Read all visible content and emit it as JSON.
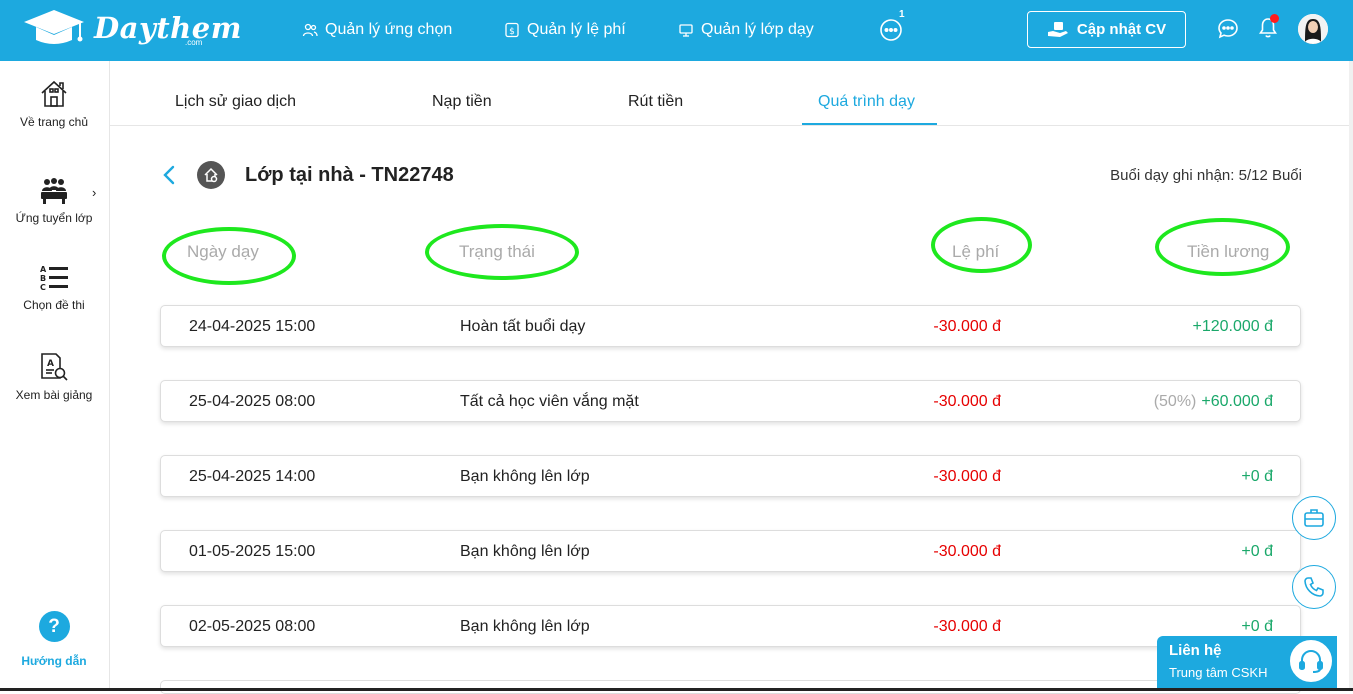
{
  "header": {
    "logo_text": "Daythem",
    "logo_sub": ".com",
    "nav": [
      {
        "label": "Quản lý ứng chọn",
        "icon": "users-icon"
      },
      {
        "label": "Quản lý lệ phí",
        "icon": "fee-icon"
      },
      {
        "label": "Quản lý lớp dạy",
        "icon": "monitor-icon"
      }
    ],
    "more_badge": "1",
    "cv_button": "Cập nhật CV"
  },
  "sidebar": {
    "items": [
      {
        "label": "Về trang chủ",
        "icon": "home-icon"
      },
      {
        "label": "Ứng tuyển lớp",
        "icon": "classroom-icon"
      },
      {
        "label": "Chọn đề thi",
        "icon": "list-icon"
      },
      {
        "label": "Xem bài giảng",
        "icon": "lecture-search-icon"
      }
    ],
    "expand_arrow": "›",
    "guide_symbol": "?",
    "guide_label": "Hướng dẫn"
  },
  "tabs": [
    {
      "label": "Lịch sử giao dịch"
    },
    {
      "label": "Nạp tiền"
    },
    {
      "label": "Rút tiền"
    },
    {
      "label": "Quá trình dạy"
    }
  ],
  "detail": {
    "class_title": "Lớp tại nhà - TN22748",
    "sessions_recorded": "Buổi dạy ghi nhận: 5/12 Buổi",
    "columns": {
      "date": "Ngày dạy",
      "status": "Trạng thái",
      "fee": "Lệ phí",
      "pay": "Tiền lương"
    },
    "rows": [
      {
        "date": "24-04-2025 15:00",
        "status": "Hoàn tất buổi dạy",
        "fee": "-30.000 đ",
        "pct": "",
        "pay": "+120.000 đ"
      },
      {
        "date": "25-04-2025 08:00",
        "status": "Tất cả học viên vắng mặt",
        "fee": "-30.000 đ",
        "pct": "(50%)",
        "pay": "+60.000 đ"
      },
      {
        "date": "25-04-2025 14:00",
        "status": "Bạn không lên lớp",
        "fee": "-30.000 đ",
        "pct": "",
        "pay": "+0 đ"
      },
      {
        "date": "01-05-2025 15:00",
        "status": "Bạn không lên lớp",
        "fee": "-30.000 đ",
        "pct": "",
        "pay": "+0 đ"
      },
      {
        "date": "02-05-2025 08:00",
        "status": "Bạn không lên lớp",
        "fee": "-30.000 đ",
        "pct": "",
        "pay": "+0 đ"
      }
    ]
  },
  "contact": {
    "title": "Liên hệ",
    "subtitle": "Trung tâm CSKH"
  },
  "colors": {
    "brand": "#1da9df",
    "fee": "#e60000",
    "pay": "#1aa86a",
    "highlight": "#1ee81e"
  }
}
